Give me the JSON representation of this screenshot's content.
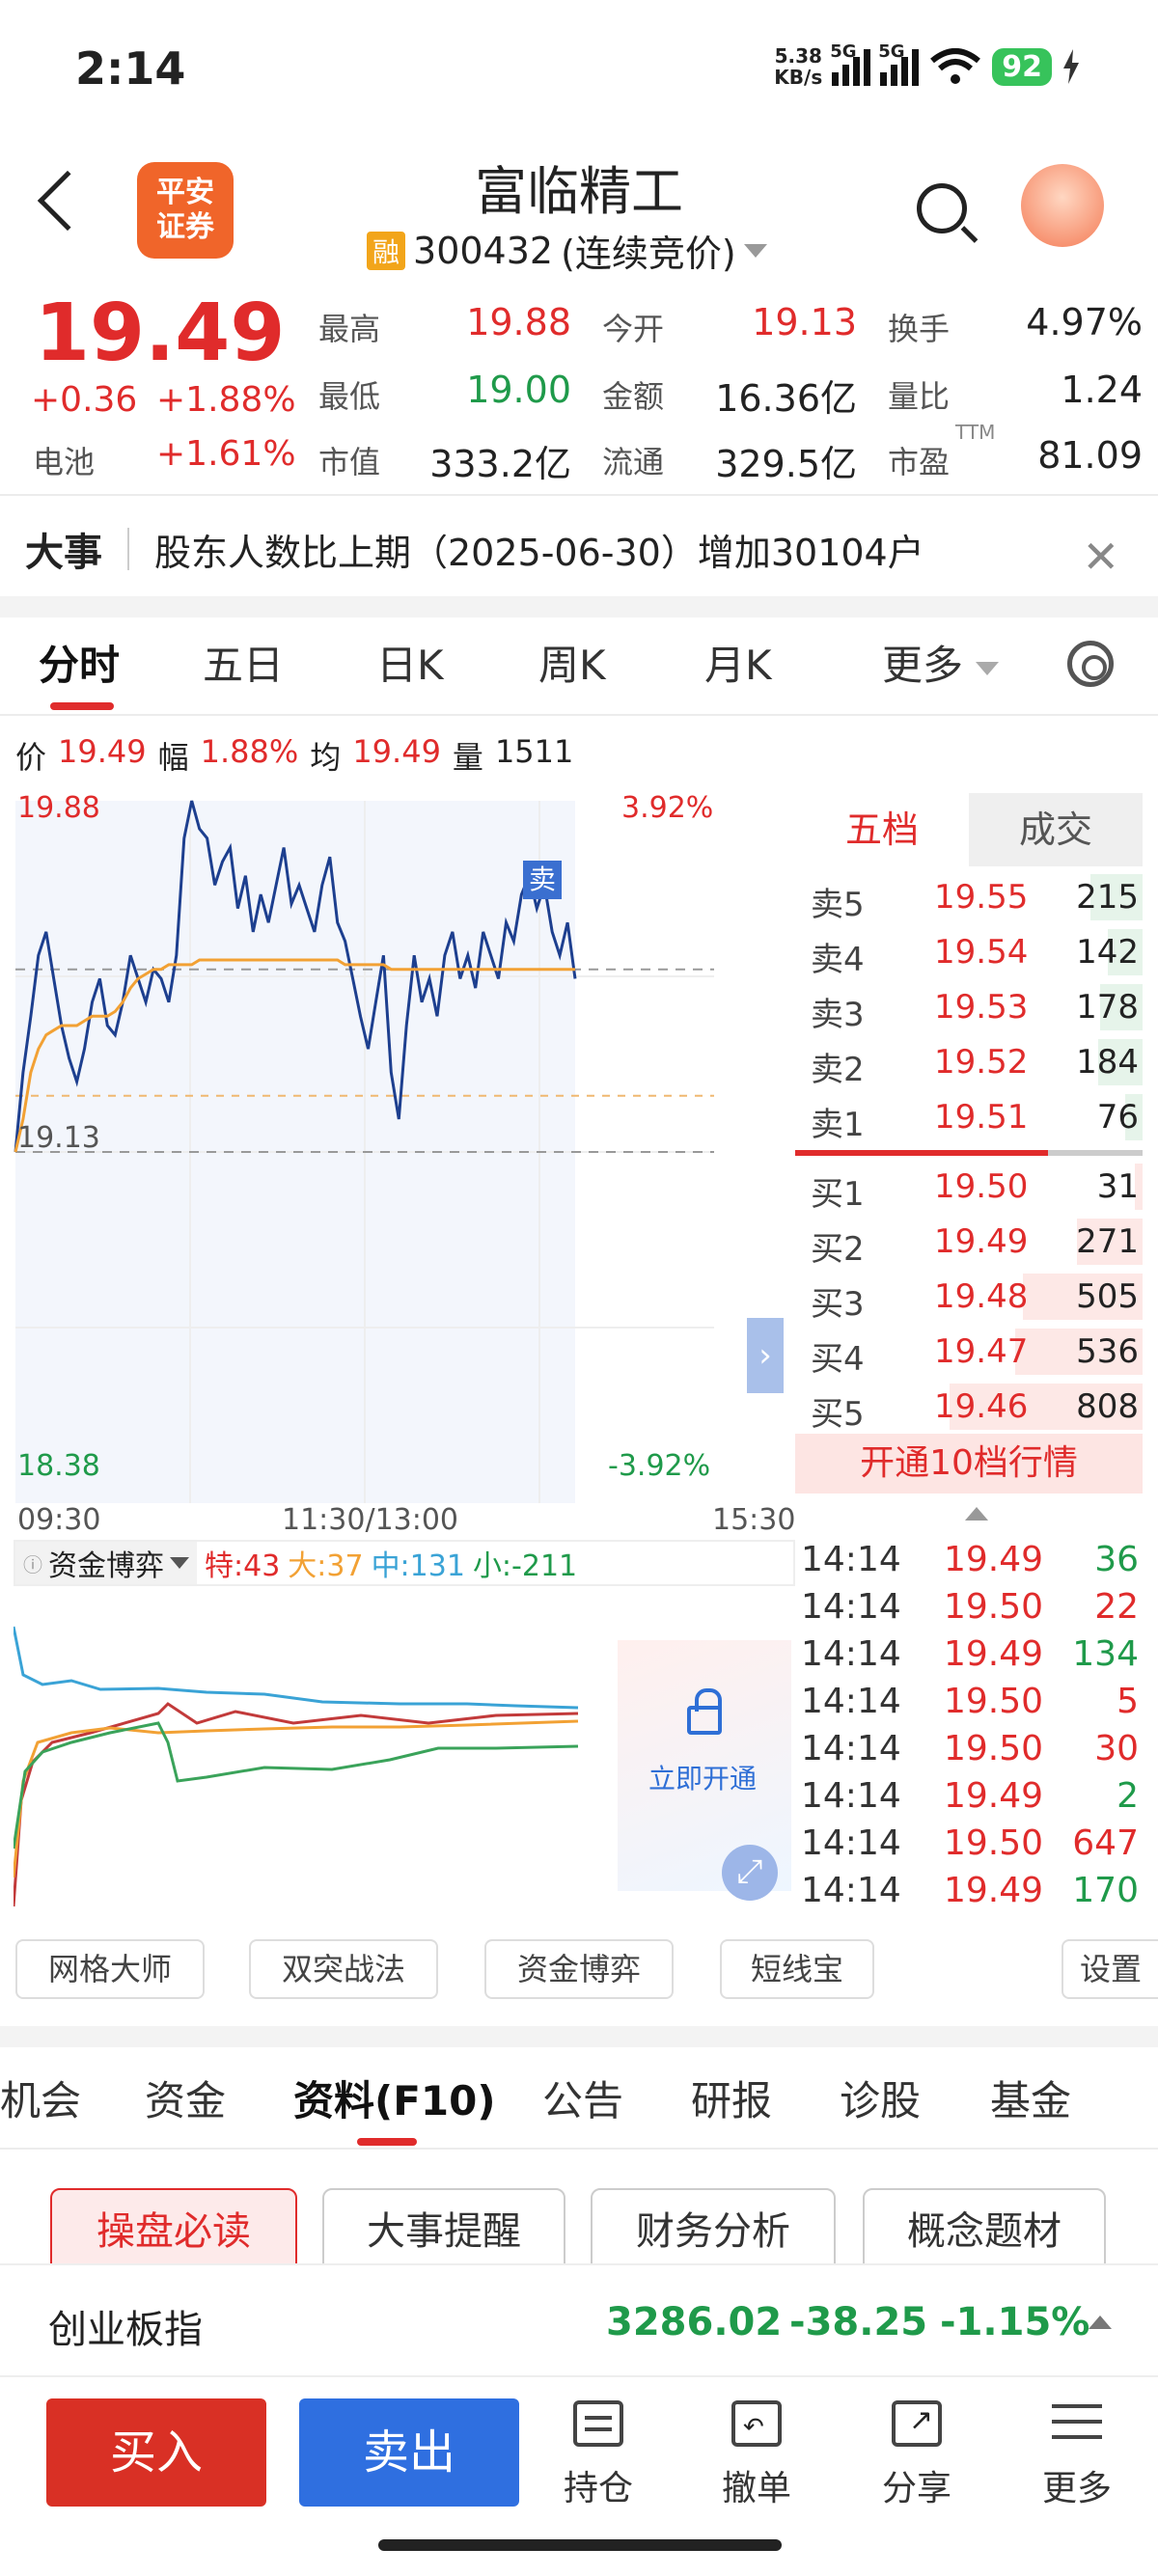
{
  "status_bar": {
    "time": "2:14",
    "net_speed": "5.38",
    "net_unit": "KB/s",
    "sig1": "5G",
    "sig2": "5G",
    "battery": "92"
  },
  "header": {
    "logo_line1": "平安",
    "logo_line2": "证券",
    "title": "富临精工",
    "badge": "融",
    "code": "300432",
    "status": "(连续竞价)"
  },
  "quote": {
    "price": "19.49",
    "change": "+0.36",
    "change_pct": "+1.88%",
    "battery_label": "电池",
    "battery_pct": "+1.61%",
    "high_label": "最高",
    "high": "19.88",
    "open_label": "今开",
    "open": "19.13",
    "turnover_label": "换手",
    "turnover": "4.97%",
    "low_label": "最低",
    "low": "19.00",
    "amount_label": "金额",
    "amount": "16.36亿",
    "vratio_label": "量比",
    "vratio": "1.24",
    "mcap_label": "市值",
    "mcap": "333.2亿",
    "float_label": "流通",
    "float": "329.5亿",
    "pe_label": "市盈",
    "pe_sup": "TTM",
    "pe": "81.09"
  },
  "news": {
    "tag": "大事",
    "text": "股东人数比上期（2025-06-30）增加30104户"
  },
  "kline_tabs": [
    "分时",
    "五日",
    "日K",
    "周K",
    "月K",
    "更多"
  ],
  "info": {
    "p_label": "价",
    "p": "19.49",
    "f_label": "幅",
    "f": "1.88%",
    "a_label": "均",
    "a": "19.49",
    "v_label": "量",
    "v": "1511"
  },
  "axis": {
    "top_price": "19.88",
    "top_pct": "3.92%",
    "base_price": "19.13",
    "bottom_price": "18.38",
    "bottom_pct": "-3.92%",
    "t_start": "09:30",
    "t_mid": "11:30/13:00",
    "t_end": "15:30"
  },
  "sell_marker": "卖",
  "chart_data": {
    "type": "line",
    "y_range": [
      18.38,
      19.88
    ],
    "x_range_minutes": [
      0,
      240
    ],
    "series": [
      {
        "values": [
          19.13,
          19.3,
          19.42,
          19.55,
          19.6,
          19.5,
          19.4,
          19.33,
          19.28,
          19.35,
          19.45,
          19.5,
          19.4,
          19.38,
          19.45,
          19.55,
          19.5,
          19.45,
          19.52,
          19.5,
          19.45,
          19.55,
          19.8,
          19.88,
          19.82,
          19.8,
          19.7,
          19.75,
          19.78,
          19.65,
          19.72,
          19.6,
          19.68,
          19.62,
          19.7,
          19.78,
          19.66,
          19.7,
          19.65,
          19.6,
          19.7,
          19.76,
          19.62,
          19.58,
          19.5,
          19.42,
          19.35,
          19.45,
          19.55,
          19.3,
          19.2,
          19.4,
          19.55,
          19.45,
          19.5,
          19.42,
          19.55,
          19.6,
          19.5,
          19.55,
          19.48,
          19.6,
          19.55,
          19.5,
          19.62,
          19.58,
          19.68,
          19.72,
          19.65,
          19.7,
          19.6,
          19.55,
          19.62,
          19.5
        ],
        "color": "#1d3f8f"
      },
      {
        "values": [
          19.13,
          19.2,
          19.3,
          19.35,
          19.38,
          19.39,
          19.4,
          19.4,
          19.4,
          19.41,
          19.42,
          19.42,
          19.42,
          19.43,
          19.45,
          19.48,
          19.5,
          19.51,
          19.52,
          19.52,
          19.53,
          19.53,
          19.53,
          19.53,
          19.54,
          19.54,
          19.54,
          19.54,
          19.54,
          19.54,
          19.54,
          19.54,
          19.54,
          19.54,
          19.54,
          19.54,
          19.54,
          19.54,
          19.54,
          19.54,
          19.54,
          19.54,
          19.54,
          19.53,
          19.53,
          19.53,
          19.53,
          19.53,
          19.53,
          19.52,
          19.52,
          19.52,
          19.52,
          19.52,
          19.52,
          19.52,
          19.52,
          19.52,
          19.52,
          19.52,
          19.52,
          19.52,
          19.52,
          19.52,
          19.52,
          19.52,
          19.52,
          19.52,
          19.52,
          19.52,
          19.52,
          19.52,
          19.52,
          19.52
        ],
        "color": "#f2a134"
      }
    ]
  },
  "orderbook": {
    "tab1": "五档",
    "tab2": "成交",
    "asks": [
      {
        "name": "卖5",
        "price": "19.55",
        "vol": "215",
        "frac": 0.27
      },
      {
        "name": "卖4",
        "price": "19.54",
        "vol": "142",
        "frac": 0.18
      },
      {
        "name": "卖3",
        "price": "19.53",
        "vol": "178",
        "frac": 0.22
      },
      {
        "name": "卖2",
        "price": "19.52",
        "vol": "184",
        "frac": 0.23
      },
      {
        "name": "卖1",
        "price": "19.51",
        "vol": "76",
        "frac": 0.09
      }
    ],
    "bids": [
      {
        "name": "买1",
        "price": "19.50",
        "vol": "31",
        "frac": 0.04
      },
      {
        "name": "买2",
        "price": "19.49",
        "vol": "271",
        "frac": 0.34
      },
      {
        "name": "买3",
        "price": "19.48",
        "vol": "505",
        "frac": 0.62
      },
      {
        "name": "买4",
        "price": "19.47",
        "vol": "536",
        "frac": 0.66
      },
      {
        "name": "买5",
        "price": "19.46",
        "vol": "808",
        "frac": 1.0
      }
    ],
    "open_btn": "开通10档行情"
  },
  "fund_flow": {
    "select": "资金博弈",
    "te": "特:43",
    "da": "大:37",
    "zhong": "中:131",
    "xiao": "小:-211",
    "lock_text": "立即开通"
  },
  "ticks": [
    {
      "t": "14:14",
      "p": "19.49",
      "v": "36",
      "c": "g"
    },
    {
      "t": "14:14",
      "p": "19.50",
      "v": "22",
      "c": "r"
    },
    {
      "t": "14:14",
      "p": "19.49",
      "v": "134",
      "c": "g"
    },
    {
      "t": "14:14",
      "p": "19.50",
      "v": "5",
      "c": "r"
    },
    {
      "t": "14:14",
      "p": "19.50",
      "v": "30",
      "c": "r"
    },
    {
      "t": "14:14",
      "p": "19.49",
      "v": "2",
      "c": "g"
    },
    {
      "t": "14:14",
      "p": "19.50",
      "v": "647",
      "c": "r"
    },
    {
      "t": "14:14",
      "p": "19.49",
      "v": "170",
      "c": "g"
    }
  ],
  "tools": [
    "网格大师",
    "双突战法",
    "资金博弈",
    "短线宝",
    "设置"
  ],
  "f10_tabs": [
    "机会",
    "资金",
    "资料(F10)",
    "公告",
    "研报",
    "诊股",
    "基金"
  ],
  "f10_buttons": [
    "操盘必读",
    "大事提醒",
    "财务分析",
    "概念题材"
  ],
  "index_bar": {
    "name": "创业板指",
    "value": "3286.02",
    "change": "-38.25",
    "pct": "-1.15%"
  },
  "bottom": {
    "buy": "买入",
    "sell": "卖出",
    "items": [
      "持仓",
      "撤单",
      "分享",
      "更多"
    ]
  },
  "colors": {
    "up": "#e02b2b",
    "down": "#1f9a4a",
    "accent_blue": "#2f6fd6"
  }
}
